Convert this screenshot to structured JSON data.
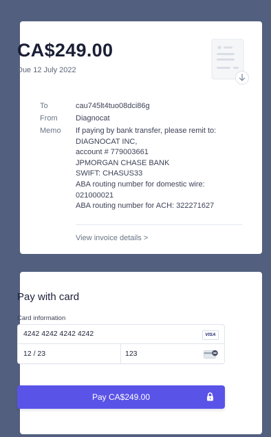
{
  "invoice": {
    "amount": "CA$249.00",
    "due": "Due 12 July 2022",
    "to_label": "To",
    "to_value": "cau745lt4tuo08dci86g",
    "from_label": "From",
    "from_value": "Diagnocat",
    "memo_label": "Memo",
    "memo_lines": [
      "If paying by bank transfer, please remit to:",
      "DIAGNOCAT INC,",
      "account # 779003661",
      "JPMORGAN CHASE BANK",
      "SWIFT: CHASUS33",
      "ABA routing number for domestic wire:",
      "021000021",
      "ABA routing number for ACH:  322271627"
    ],
    "view_details": "View invoice details >"
  },
  "payment": {
    "title": "Pay with card",
    "card_info_label": "Card information",
    "card_number": "4242 4242 4242 4242",
    "card_brand": "VISA",
    "expiry": "12 / 23",
    "cvc": "123",
    "pay_button": "Pay CA$249.00"
  },
  "icons": {
    "document": "invoice-document-icon",
    "visa": "visa-icon",
    "cvc": "cvc-card-icon",
    "lock": "lock-icon"
  },
  "colors": {
    "background": "#525f7f",
    "accent": "#5a53e8",
    "text_primary": "#1a1f36",
    "text_secondary": "#697386"
  }
}
